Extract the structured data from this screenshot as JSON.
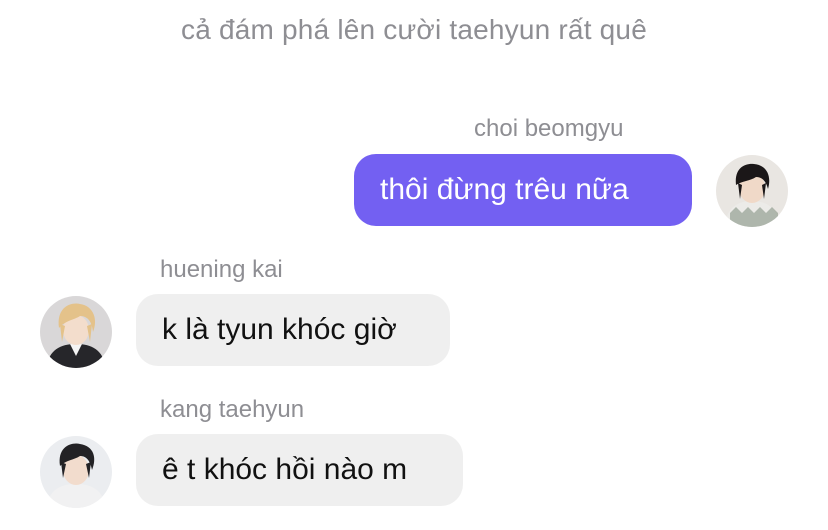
{
  "system_message": "cả đám phá lên cười taehyun rất quê",
  "messages": [
    {
      "sender": "choi beomgyu",
      "text": "thôi đừng trêu nữa",
      "direction": "outgoing",
      "avatar": "beomgyu-avatar-photo"
    },
    {
      "sender": "huening kai",
      "text": "k là tyun khóc giờ",
      "direction": "incoming",
      "avatar": "huening-kai-avatar-photo"
    },
    {
      "sender": "kang taehyun",
      "text": "ê t khóc hồi nào m",
      "direction": "incoming",
      "avatar": "taehyun-avatar-photo"
    }
  ],
  "colors": {
    "outgoing_bubble": "#7360f2",
    "incoming_bubble": "#efefef",
    "meta_text": "#8e8e93"
  }
}
